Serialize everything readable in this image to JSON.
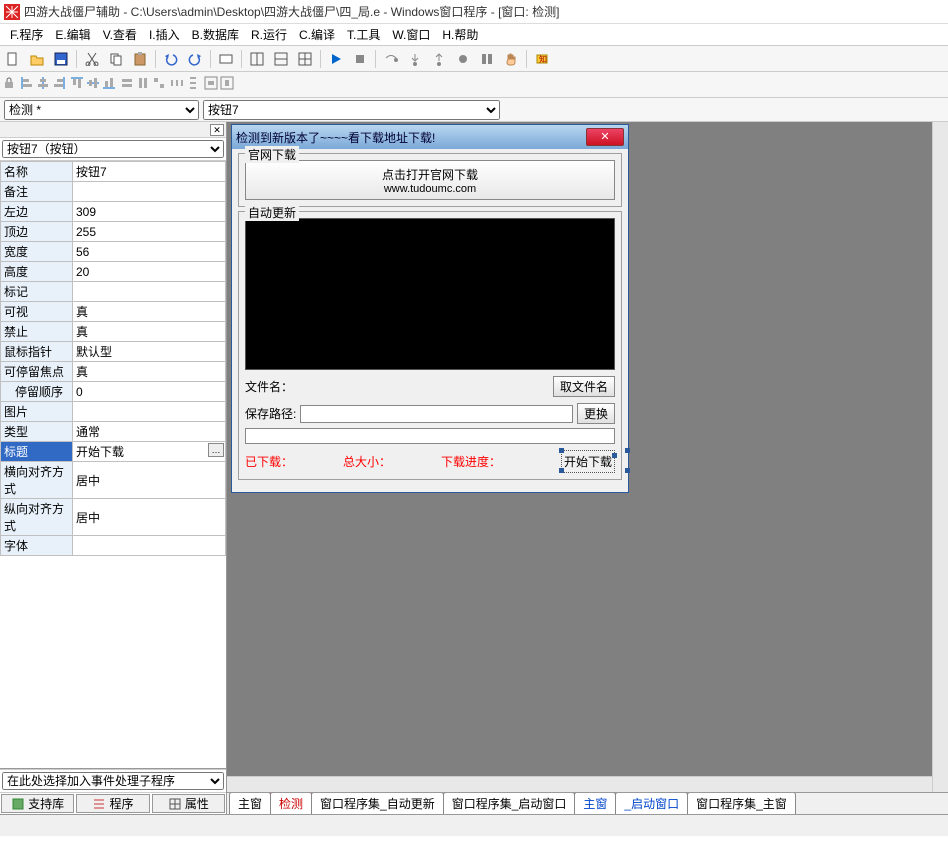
{
  "title": "四游大战僵尸辅助 - C:\\Users\\admin\\Desktop\\四游大战僵尸\\四_局.e - Windows窗口程序 - [窗口: 检测]",
  "menu": {
    "program": "F.程序",
    "edit": "E.编辑",
    "view": "V.查看",
    "insert": "I.插入",
    "database": "B.数据库",
    "run": "R.运行",
    "compile": "C.编译",
    "tools": "T.工具",
    "window": "W.窗口",
    "help": "H.帮助"
  },
  "combo": {
    "left": "检测 *",
    "right": "按钮7"
  },
  "sidebar": {
    "object": "按钮7（按钮）",
    "event_placeholder": "在此处选择加入事件处理子程序",
    "tabs": {
      "lib": "支持库",
      "program": "程序",
      "property": "属性"
    }
  },
  "properties": [
    {
      "name": "名称",
      "value": "按钮7"
    },
    {
      "name": "备注",
      "value": ""
    },
    {
      "name": "左边",
      "value": "309"
    },
    {
      "name": "顶边",
      "value": "255"
    },
    {
      "name": "宽度",
      "value": "56"
    },
    {
      "name": "高度",
      "value": "20"
    },
    {
      "name": "标记",
      "value": ""
    },
    {
      "name": "可视",
      "value": "真"
    },
    {
      "name": "禁止",
      "value": "真"
    },
    {
      "name": "鼠标指针",
      "value": "默认型"
    },
    {
      "name": "可停留焦点",
      "value": "真"
    },
    {
      "name": "停留顺序",
      "value": "0",
      "indent": true
    },
    {
      "name": "图片",
      "value": ""
    },
    {
      "name": "类型",
      "value": "通常"
    },
    {
      "name": "标题",
      "value": "开始下载",
      "selected": true
    },
    {
      "name": "横向对齐方式",
      "value": "居中"
    },
    {
      "name": "纵向对齐方式",
      "value": "居中"
    },
    {
      "name": "字体",
      "value": ""
    }
  ],
  "form": {
    "title": "检测到新版本了~~~~看下载地址下载!",
    "group1": {
      "legend": "官网下载",
      "button_main": "点击打开官网下载",
      "button_sub": "www.tudoumc.com"
    },
    "group2": {
      "legend": "自动更新",
      "file_label": "文件名：",
      "get_file_btn": "取文件名",
      "path_label": "保存路径:",
      "change_btn": "更换",
      "downloaded": "已下载：",
      "total_size": "总大小：",
      "progress": "下载进度：",
      "start_download": "开始下载"
    }
  },
  "bottom_tabs": [
    "主窗",
    "检测",
    "窗口程序集_自动更新",
    "窗口程序集_启动窗口",
    "主窗",
    "_启动窗口",
    "窗口程序集_主窗"
  ],
  "statusbar": {}
}
